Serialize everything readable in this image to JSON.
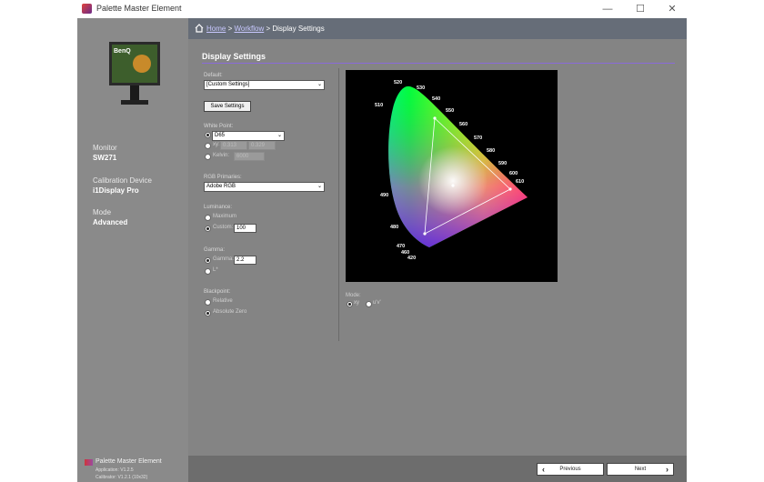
{
  "window": {
    "title": "Palette Master Element",
    "minimize_icon": "minimize-icon",
    "maximize_icon": "maximize-icon",
    "close_icon": "close-icon"
  },
  "sidebar": {
    "monitor_brand": "BenQ",
    "monitor_label": "Monitor",
    "monitor_value": "SW271",
    "device_label": "Calibration Device",
    "device_value": "i1Display Pro",
    "mode_label": "Mode",
    "mode_value": "Advanced",
    "footer_title": "Palette Master Element",
    "footer_app": "Application: V1.2.5",
    "footer_cal": "Calibrator: V1.2.1 (10x32)"
  },
  "breadcrumb": {
    "home": "Home",
    "sep": ">",
    "workflow": "Workflow",
    "current": "Display Settings"
  },
  "main": {
    "title": "Display Settings",
    "default_label": "Default:",
    "default_value": "[Custom Settings]",
    "save_button": "Save Settings",
    "white_point_label": "White Point:",
    "white_point_value": "D65",
    "xy_label": "xy:",
    "xy_x": "0.313",
    "xy_y": "0.329",
    "kelvin_label": "Kelvin:",
    "kelvin_value": "6000",
    "primaries_label": "RGB Primaries:",
    "primaries_value": "Adobe RGB",
    "luminance_label": "Luminance:",
    "lum_max": "Maximum",
    "lum_custom": "Custom:",
    "lum_value": "100",
    "gamma_label": "Gamma:",
    "gamma_opt": "Gamma:",
    "gamma_value": "2.2",
    "lstar": "L*",
    "blackpoint_label": "Blackpoint:",
    "bp_relative": "Relative",
    "bp_absolute": "Absolute Zero",
    "mode_label": "Mode:",
    "mode_xy": "xy",
    "mode_uv": "u'v'",
    "wavelengths": [
      "520",
      "530",
      "540",
      "550",
      "560",
      "570",
      "580",
      "590",
      "600",
      "610",
      "510",
      "490",
      "480",
      "470",
      "460",
      "420"
    ]
  },
  "footer": {
    "previous": "Previous",
    "next": "Next"
  },
  "colors": {
    "header": "#666d78",
    "accent": "#8a6bd8",
    "sidebar": "#8a8a8a"
  }
}
